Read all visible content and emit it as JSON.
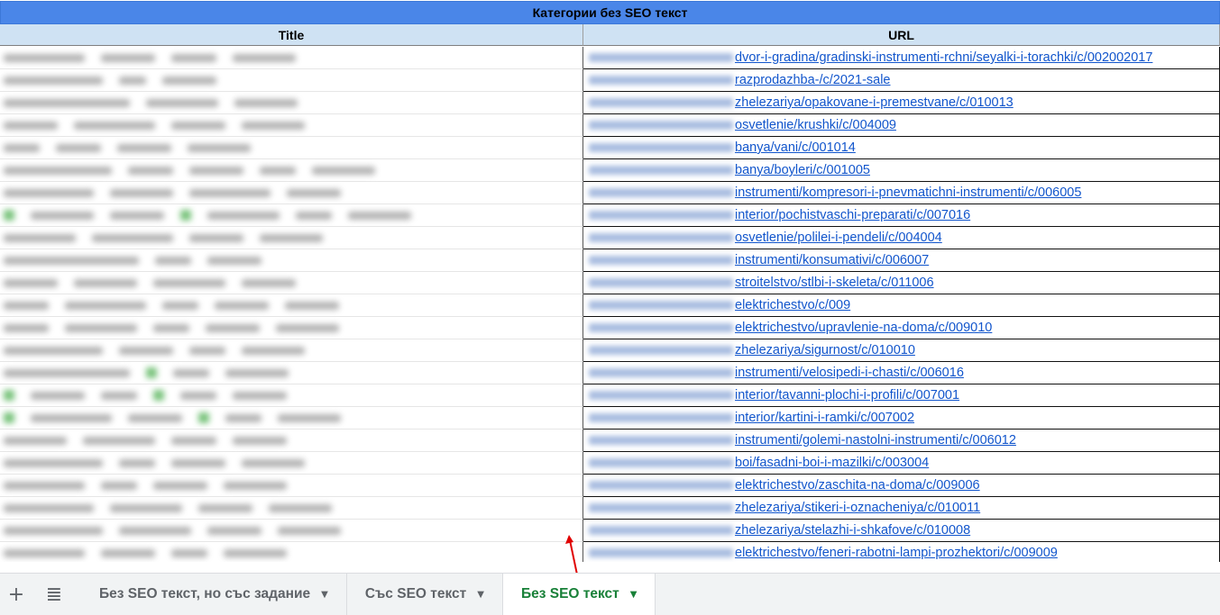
{
  "sheet": {
    "title_row": "Категории без SEO текст",
    "columns": [
      "Title",
      "URL"
    ],
    "rows": [
      {
        "url": "dvor-i-gradina/gradinski-instrumenti-rchni/seyalki-i-torachki/c/002002017"
      },
      {
        "url": "razprodazhba-/c/2021-sale"
      },
      {
        "url": "zhelezariya/opakovane-i-premestvane/c/010013"
      },
      {
        "url": "osvetlenie/krushki/c/004009"
      },
      {
        "url": "banya/vani/c/001014"
      },
      {
        "url": "banya/boyleri/c/001005"
      },
      {
        "url": "instrumenti/kompresori-i-pnevmatichni-instrumenti/c/006005"
      },
      {
        "url": "interior/pochistvaschi-preparati/c/007016"
      },
      {
        "url": "osvetlenie/polilei-i-pendeli/c/004004"
      },
      {
        "url": "instrumenti/konsumativi/c/006007"
      },
      {
        "url": "stroitelstvo/stlbi-i-skeleta/c/011006"
      },
      {
        "url": "elektrichestvo/c/009"
      },
      {
        "url": "elektrichestvo/upravlenie-na-doma/c/009010"
      },
      {
        "url": "zhelezariya/sigurnost/c/010010"
      },
      {
        "url": "instrumenti/velosipedi-i-chasti/c/006016"
      },
      {
        "url": "interior/tavanni-plochi-i-profili/c/007001"
      },
      {
        "url": "interior/kartini-i-ramki/c/007002"
      },
      {
        "url": "instrumenti/golemi-nastolni-instrumenti/c/006012"
      },
      {
        "url": "boi/fasadni-boi-i-mazilki/c/003004"
      },
      {
        "url": "elektrichestvo/zaschita-na-doma/c/009006"
      },
      {
        "url": "zhelezariya/stikeri-i-oznacheniya/c/010011"
      },
      {
        "url": "zhelezariya/stelazhi-i-shkafove/c/010008"
      },
      {
        "url": "elektrichestvo/feneri-rabotni-lampi-prozhektori/c/009009"
      }
    ]
  },
  "tabbar": {
    "add_icon": "+",
    "list_icon": "≣",
    "tabs": [
      {
        "label": "Без SEO текст, но със задание",
        "active": false
      },
      {
        "label": "Със SEO текст",
        "active": false
      },
      {
        "label": "Без SEO текст",
        "active": true
      }
    ]
  },
  "colors": {
    "title_row_bg": "#4a86e8",
    "header_bg": "#cfe2f3",
    "link": "#1155cc",
    "active_tab": "#188038",
    "annotation_arrow": "#e00000"
  }
}
